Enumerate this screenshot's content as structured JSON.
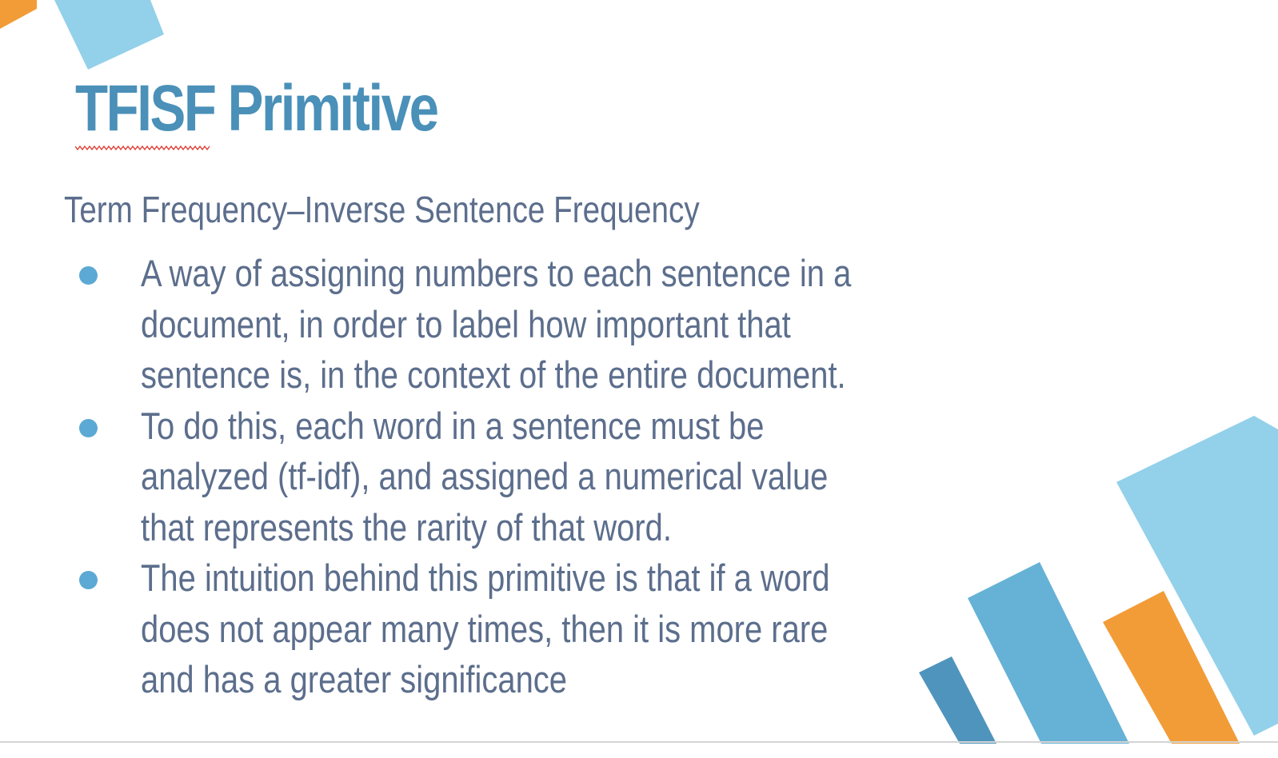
{
  "slide": {
    "title": "TFISF Primitive",
    "subtitle": "Term Frequency–Inverse Sentence Frequency",
    "bullets": [
      {
        "lines": [
          "A way of assigning numbers to each sentence in a",
          "document, in order to label how important that",
          "sentence is, in the context of the entire document."
        ]
      },
      {
        "lines": [
          "To do this, each word in a sentence must be",
          "analyzed (tf-idf), and assigned a numerical value",
          "that represents the rarity of that word."
        ]
      },
      {
        "lines": [
          "The intuition behind this primitive is that if a word",
          "does not appear many times, then it is more rare",
          "and has a greater significance"
        ]
      }
    ]
  },
  "colors": {
    "title": "#4a90b8",
    "body_text": "#5c6e8c",
    "bullet": "#5ba9d4",
    "light_blue": "#93d0ea",
    "mid_blue": "#66b1d6",
    "dark_blue": "#4f94bd",
    "orange": "#f29c38",
    "spellcheck_underline": "#e03a2e"
  }
}
